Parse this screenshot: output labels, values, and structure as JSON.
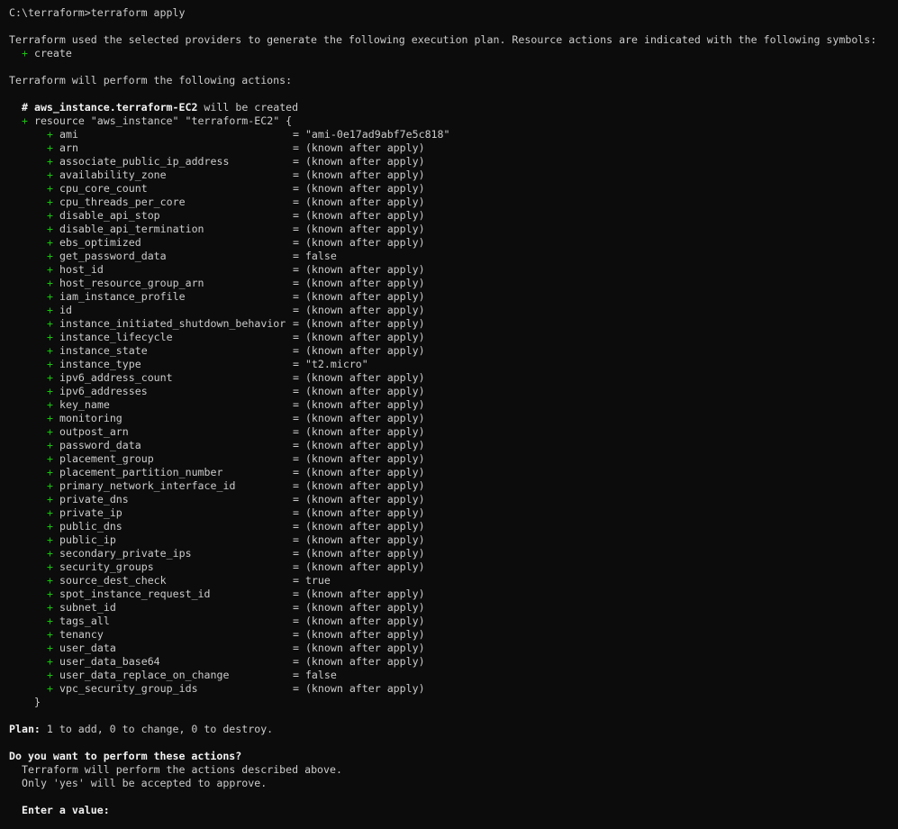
{
  "prompt_line": "C:\\terraform>terraform apply",
  "intro_text": "Terraform used the selected providers to generate the following execution plan. Resource actions are indicated with the following symbols:",
  "symbol_legend": {
    "symbol": "+",
    "label": "create"
  },
  "perform_text": "Terraform will perform the following actions:",
  "resource_comment": {
    "hash": "#",
    "address": "aws_instance.terraform-EC2",
    "suffix": " will be created"
  },
  "resource_header": {
    "symbol": "+",
    "text": "resource \"aws_instance\" \"terraform-EC2\" {"
  },
  "attributes": [
    {
      "name": "ami",
      "value": "\"ami-0e17ad9abf7e5c818\""
    },
    {
      "name": "arn",
      "value": "(known after apply)"
    },
    {
      "name": "associate_public_ip_address",
      "value": "(known after apply)"
    },
    {
      "name": "availability_zone",
      "value": "(known after apply)"
    },
    {
      "name": "cpu_core_count",
      "value": "(known after apply)"
    },
    {
      "name": "cpu_threads_per_core",
      "value": "(known after apply)"
    },
    {
      "name": "disable_api_stop",
      "value": "(known after apply)"
    },
    {
      "name": "disable_api_termination",
      "value": "(known after apply)"
    },
    {
      "name": "ebs_optimized",
      "value": "(known after apply)"
    },
    {
      "name": "get_password_data",
      "value": "false"
    },
    {
      "name": "host_id",
      "value": "(known after apply)"
    },
    {
      "name": "host_resource_group_arn",
      "value": "(known after apply)"
    },
    {
      "name": "iam_instance_profile",
      "value": "(known after apply)"
    },
    {
      "name": "id",
      "value": "(known after apply)"
    },
    {
      "name": "instance_initiated_shutdown_behavior",
      "value": "(known after apply)"
    },
    {
      "name": "instance_lifecycle",
      "value": "(known after apply)"
    },
    {
      "name": "instance_state",
      "value": "(known after apply)"
    },
    {
      "name": "instance_type",
      "value": "\"t2.micro\""
    },
    {
      "name": "ipv6_address_count",
      "value": "(known after apply)"
    },
    {
      "name": "ipv6_addresses",
      "value": "(known after apply)"
    },
    {
      "name": "key_name",
      "value": "(known after apply)"
    },
    {
      "name": "monitoring",
      "value": "(known after apply)"
    },
    {
      "name": "outpost_arn",
      "value": "(known after apply)"
    },
    {
      "name": "password_data",
      "value": "(known after apply)"
    },
    {
      "name": "placement_group",
      "value": "(known after apply)"
    },
    {
      "name": "placement_partition_number",
      "value": "(known after apply)"
    },
    {
      "name": "primary_network_interface_id",
      "value": "(known after apply)"
    },
    {
      "name": "private_dns",
      "value": "(known after apply)"
    },
    {
      "name": "private_ip",
      "value": "(known after apply)"
    },
    {
      "name": "public_dns",
      "value": "(known after apply)"
    },
    {
      "name": "public_ip",
      "value": "(known after apply)"
    },
    {
      "name": "secondary_private_ips",
      "value": "(known after apply)"
    },
    {
      "name": "security_groups",
      "value": "(known after apply)"
    },
    {
      "name": "source_dest_check",
      "value": "true"
    },
    {
      "name": "spot_instance_request_id",
      "value": "(known after apply)"
    },
    {
      "name": "subnet_id",
      "value": "(known after apply)"
    },
    {
      "name": "tags_all",
      "value": "(known after apply)"
    },
    {
      "name": "tenancy",
      "value": "(known after apply)"
    },
    {
      "name": "user_data",
      "value": "(known after apply)"
    },
    {
      "name": "user_data_base64",
      "value": "(known after apply)"
    },
    {
      "name": "user_data_replace_on_change",
      "value": "false"
    },
    {
      "name": "vpc_security_group_ids",
      "value": "(known after apply)"
    }
  ],
  "closing_brace": "}",
  "plan": {
    "label": "Plan:",
    "text": " 1 to add, 0 to change, 0 to destroy."
  },
  "confirm": {
    "question": "Do you want to perform these actions?",
    "line1": "Terraform will perform the actions described above.",
    "line2": "Only 'yes' will be accepted to approve.",
    "input_label": "Enter a value:",
    "input_value": ""
  },
  "colors": {
    "background": "#0c0c0c",
    "text": "#cccccc",
    "bold_text": "#f2f2f2",
    "create_symbol": "#16c60c"
  }
}
